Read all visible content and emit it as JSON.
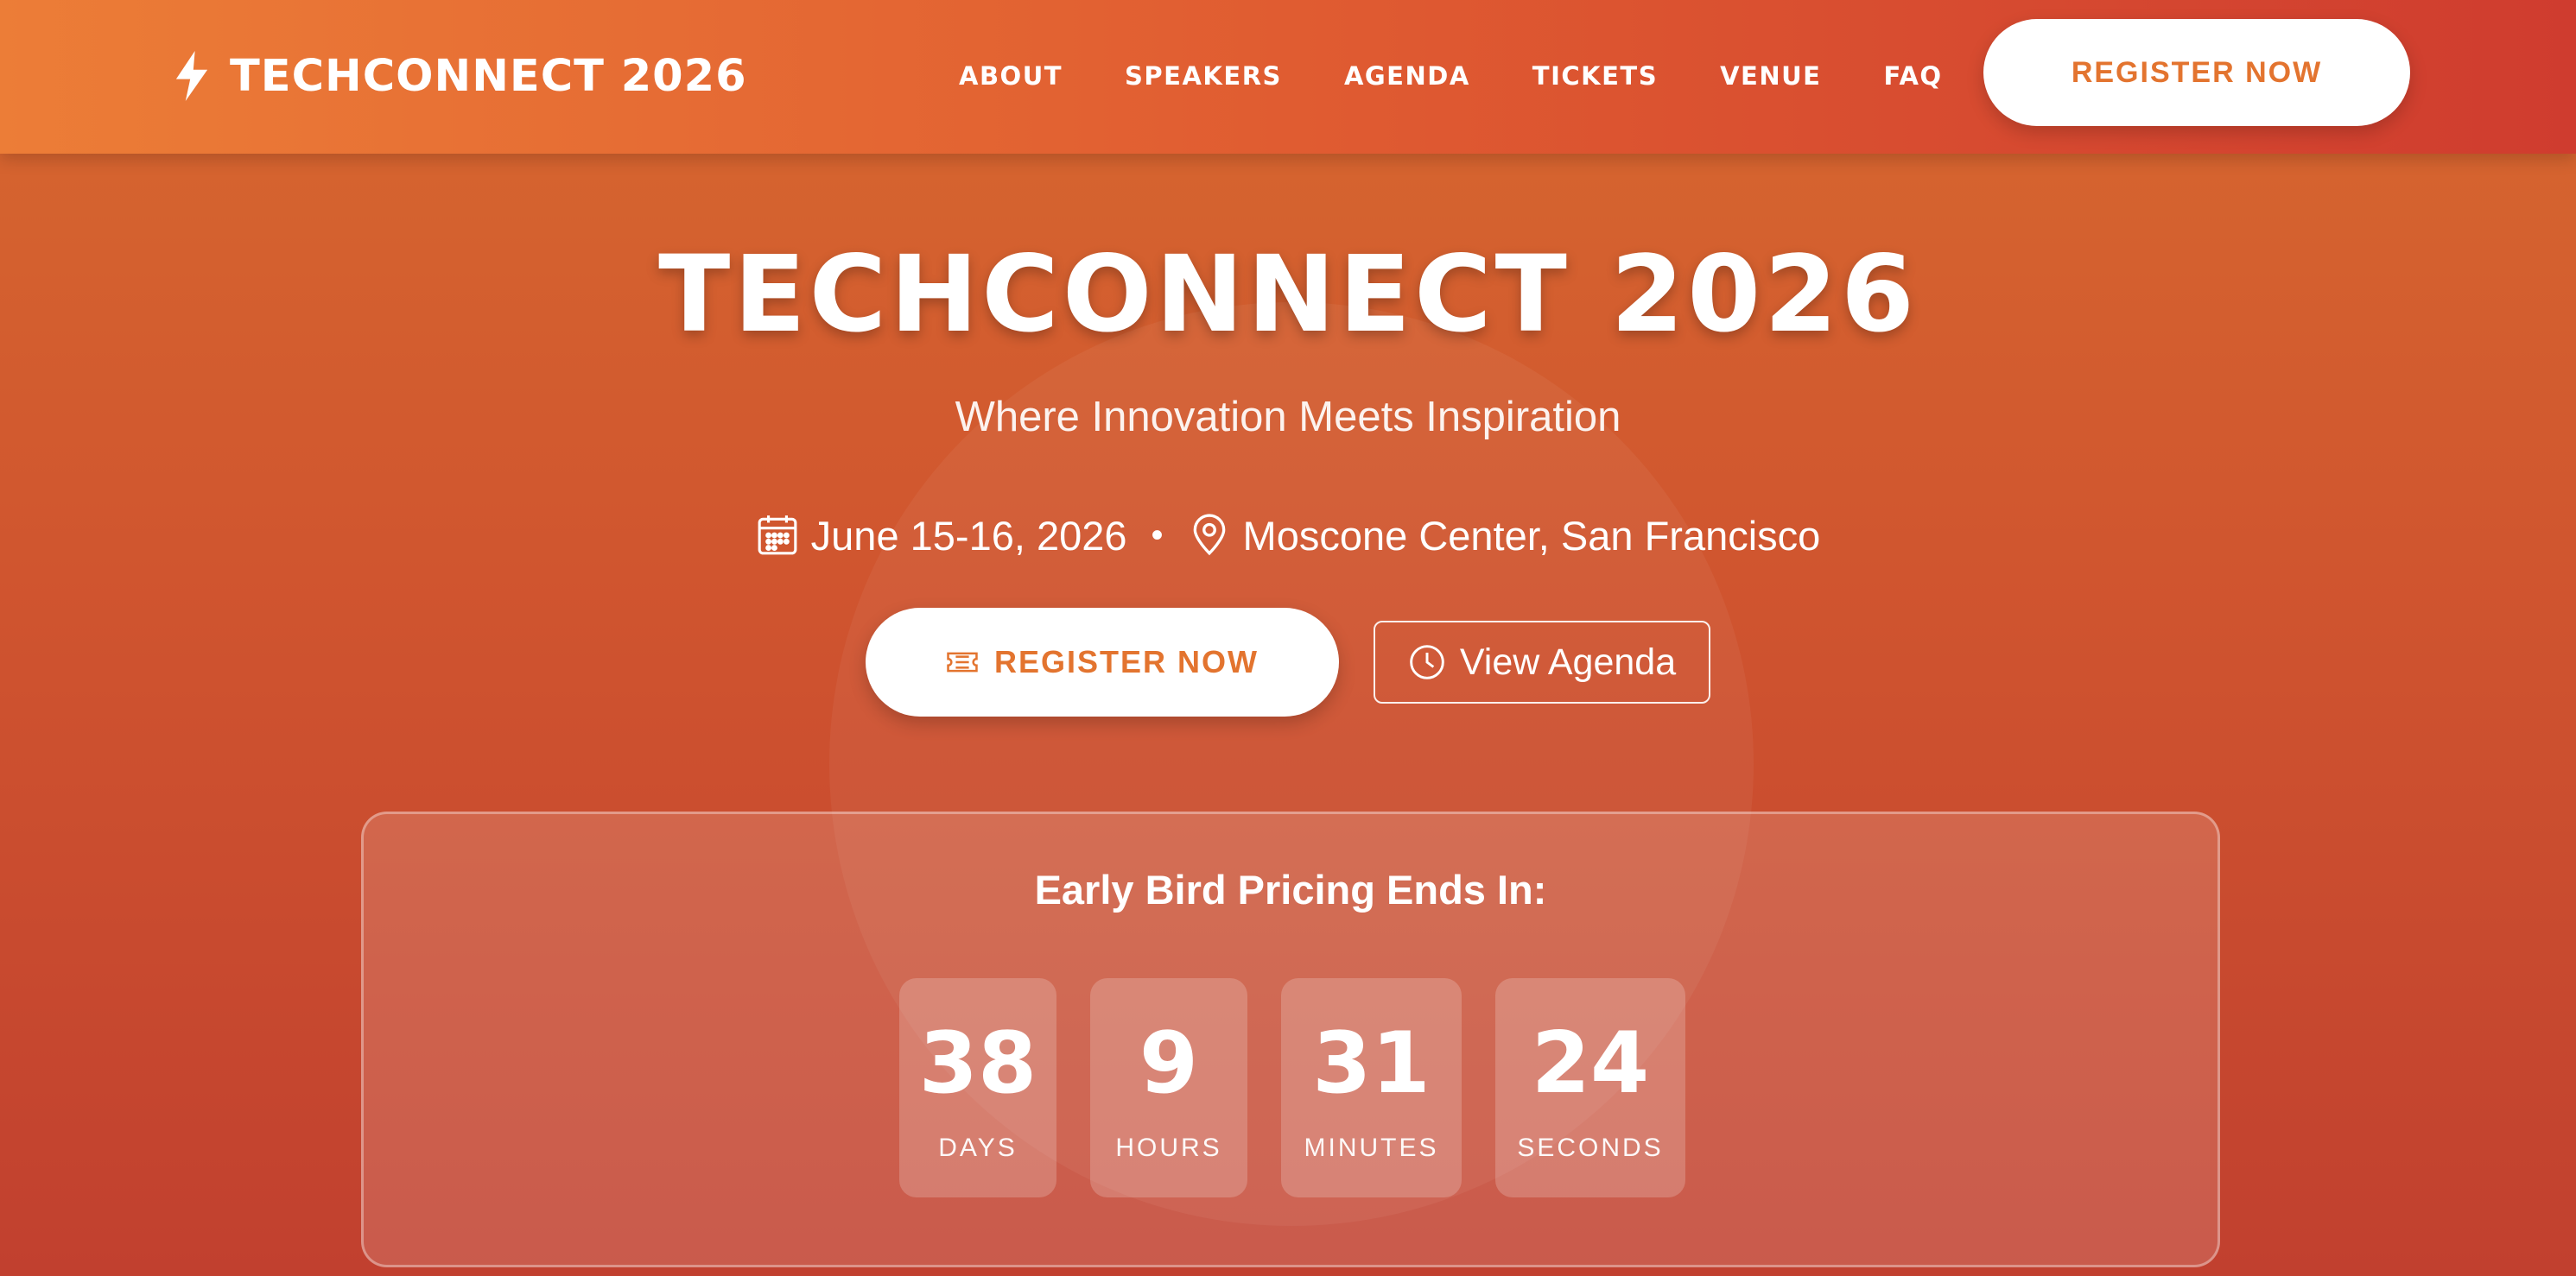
{
  "brand": {
    "name": "TECHCONNECT 2026",
    "icon": "lightning-icon"
  },
  "nav": {
    "links": [
      "ABOUT",
      "SPEAKERS",
      "AGENDA",
      "TICKETS",
      "VENUE",
      "FAQ"
    ],
    "cta_label": "REGISTER NOW"
  },
  "hero": {
    "title": "TECHCONNECT 2026",
    "tagline": "Where Innovation Meets Inspiration",
    "date": "June 15-16, 2026",
    "separator": "•",
    "location": "Moscone Center, San Francisco",
    "primary_button": "REGISTER NOW",
    "secondary_button": "View Agenda"
  },
  "countdown": {
    "title": "Early Bird Pricing Ends In:",
    "units": [
      {
        "value": "38",
        "label": "DAYS"
      },
      {
        "value": "9",
        "label": "HOURS"
      },
      {
        "value": "31",
        "label": "MINUTES"
      },
      {
        "value": "24",
        "label": "SECONDS"
      }
    ]
  },
  "colors": {
    "accent": "#e3742f",
    "nav_start": "#ec7d37",
    "nav_end": "#cf3c2f",
    "white": "#ffffff"
  }
}
